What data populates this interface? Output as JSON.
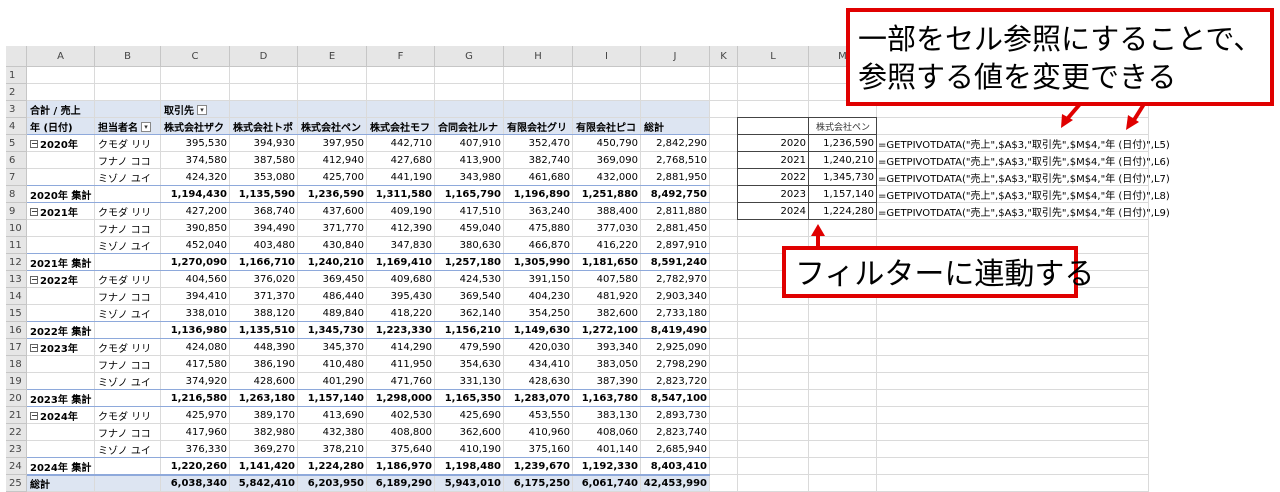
{
  "columns": [
    "A",
    "B",
    "C",
    "D",
    "E",
    "F",
    "G",
    "H",
    "I",
    "J",
    "K",
    "L",
    "M"
  ],
  "rows": [
    "1",
    "2",
    "3",
    "4",
    "5",
    "6",
    "7",
    "8",
    "9",
    "10",
    "11",
    "12",
    "13",
    "14",
    "15",
    "16",
    "17",
    "18",
    "19",
    "20",
    "21",
    "22",
    "23",
    "24",
    "25"
  ],
  "pivot": {
    "value_label": "合計 / 売上",
    "column_field": "取引先",
    "row_field_year": "年 (日付)",
    "row_field_person": "担当者名",
    "headers": [
      "株式会社ザク",
      "株式会社トポ",
      "株式会社ペン",
      "株式会社モフ",
      "合同会社ルナ",
      "有限会社グリ",
      "有限会社ピコ",
      "総計"
    ],
    "persons": [
      "クモダ リリ",
      "フナノ ココ",
      "ミゾノ ユイ"
    ],
    "groups": [
      {
        "year": "2020年",
        "rows": [
          [
            "395,530",
            "394,930",
            "397,950",
            "442,710",
            "407,910",
            "352,470",
            "450,790",
            "2,842,290"
          ],
          [
            "374,580",
            "387,580",
            "412,940",
            "427,680",
            "413,900",
            "382,740",
            "369,090",
            "2,768,510"
          ],
          [
            "424,320",
            "353,080",
            "425,700",
            "441,190",
            "343,980",
            "461,680",
            "432,000",
            "2,881,950"
          ]
        ],
        "subtotal_label": "2020年 集計",
        "subtotal": [
          "1,194,430",
          "1,135,590",
          "1,236,590",
          "1,311,580",
          "1,165,790",
          "1,196,890",
          "1,251,880",
          "8,492,750"
        ]
      },
      {
        "year": "2021年",
        "rows": [
          [
            "427,200",
            "368,740",
            "437,600",
            "409,190",
            "417,510",
            "363,240",
            "388,400",
            "2,811,880"
          ],
          [
            "390,850",
            "394,490",
            "371,770",
            "412,390",
            "459,040",
            "475,880",
            "377,030",
            "2,881,450"
          ],
          [
            "452,040",
            "403,480",
            "430,840",
            "347,830",
            "380,630",
            "466,870",
            "416,220",
            "2,897,910"
          ]
        ],
        "subtotal_label": "2021年 集計",
        "subtotal": [
          "1,270,090",
          "1,166,710",
          "1,240,210",
          "1,169,410",
          "1,257,180",
          "1,305,990",
          "1,181,650",
          "8,591,240"
        ]
      },
      {
        "year": "2022年",
        "rows": [
          [
            "404,560",
            "376,020",
            "369,450",
            "409,680",
            "424,530",
            "391,150",
            "407,580",
            "2,782,970"
          ],
          [
            "394,410",
            "371,370",
            "486,440",
            "395,430",
            "369,540",
            "404,230",
            "481,920",
            "2,903,340"
          ],
          [
            "338,010",
            "388,120",
            "489,840",
            "418,220",
            "362,140",
            "354,250",
            "382,600",
            "2,733,180"
          ]
        ],
        "subtotal_label": "2022年 集計",
        "subtotal": [
          "1,136,980",
          "1,135,510",
          "1,345,730",
          "1,223,330",
          "1,156,210",
          "1,149,630",
          "1,272,100",
          "8,419,490"
        ]
      },
      {
        "year": "2023年",
        "rows": [
          [
            "424,080",
            "448,390",
            "345,370",
            "414,290",
            "479,590",
            "420,030",
            "393,340",
            "2,925,090"
          ],
          [
            "417,580",
            "386,190",
            "410,480",
            "411,950",
            "354,630",
            "434,410",
            "383,050",
            "2,798,290"
          ],
          [
            "374,920",
            "428,600",
            "401,290",
            "471,760",
            "331,130",
            "428,630",
            "387,390",
            "2,823,720"
          ]
        ],
        "subtotal_label": "2023年 集計",
        "subtotal": [
          "1,216,580",
          "1,263,180",
          "1,157,140",
          "1,298,000",
          "1,165,350",
          "1,283,070",
          "1,163,780",
          "8,547,100"
        ]
      },
      {
        "year": "2024年",
        "rows": [
          [
            "425,970",
            "389,170",
            "413,690",
            "402,530",
            "425,690",
            "453,550",
            "383,130",
            "2,893,730"
          ],
          [
            "417,960",
            "382,980",
            "432,380",
            "408,800",
            "362,600",
            "410,960",
            "408,060",
            "2,823,740"
          ],
          [
            "376,330",
            "369,270",
            "378,210",
            "375,640",
            "410,190",
            "375,160",
            "401,140",
            "2,685,940"
          ]
        ],
        "subtotal_label": "2024年 集計",
        "subtotal": [
          "1,220,260",
          "1,141,420",
          "1,224,280",
          "1,186,970",
          "1,198,480",
          "1,239,670",
          "1,192,330",
          "8,403,410"
        ]
      }
    ],
    "total_label": "総計",
    "total": [
      "6,038,340",
      "5,842,410",
      "6,203,950",
      "6,189,290",
      "5,943,010",
      "6,175,250",
      "6,061,740",
      "42,453,990"
    ]
  },
  "side": {
    "header": "株式会社ペン",
    "rows": [
      {
        "year": "2020",
        "value": "1,236,590",
        "formula": "=GETPIVOTDATA(\"売上\",$A$3,\"取引先\",$M$4,\"年 (日付)\",L5)"
      },
      {
        "year": "2021",
        "value": "1,240,210",
        "formula": "=GETPIVOTDATA(\"売上\",$A$3,\"取引先\",$M$4,\"年 (日付)\",L6)"
      },
      {
        "year": "2022",
        "value": "1,345,730",
        "formula": "=GETPIVOTDATA(\"売上\",$A$3,\"取引先\",$M$4,\"年 (日付)\",L7)"
      },
      {
        "year": "2023",
        "value": "1,157,140",
        "formula": "=GETPIVOTDATA(\"売上\",$A$3,\"取引先\",$M$4,\"年 (日付)\",L8)"
      },
      {
        "year": "2024",
        "value": "1,224,280",
        "formula": "=GETPIVOTDATA(\"売上\",$A$3,\"取引先\",$M$4,\"年 (日付)\",L9)"
      }
    ]
  },
  "callouts": {
    "top_line1": "一部をセル参照にすることで、",
    "top_line2": "参照する値を変更できる",
    "bottom": "フィルターに連動する"
  },
  "colors": {
    "callout_border": "#e00000",
    "arrow": "#e00000",
    "pivot_band": "#dde5f2"
  },
  "icons": {
    "filter": "filter-dropdown-icon",
    "collapse": "collapse-minus-icon"
  }
}
